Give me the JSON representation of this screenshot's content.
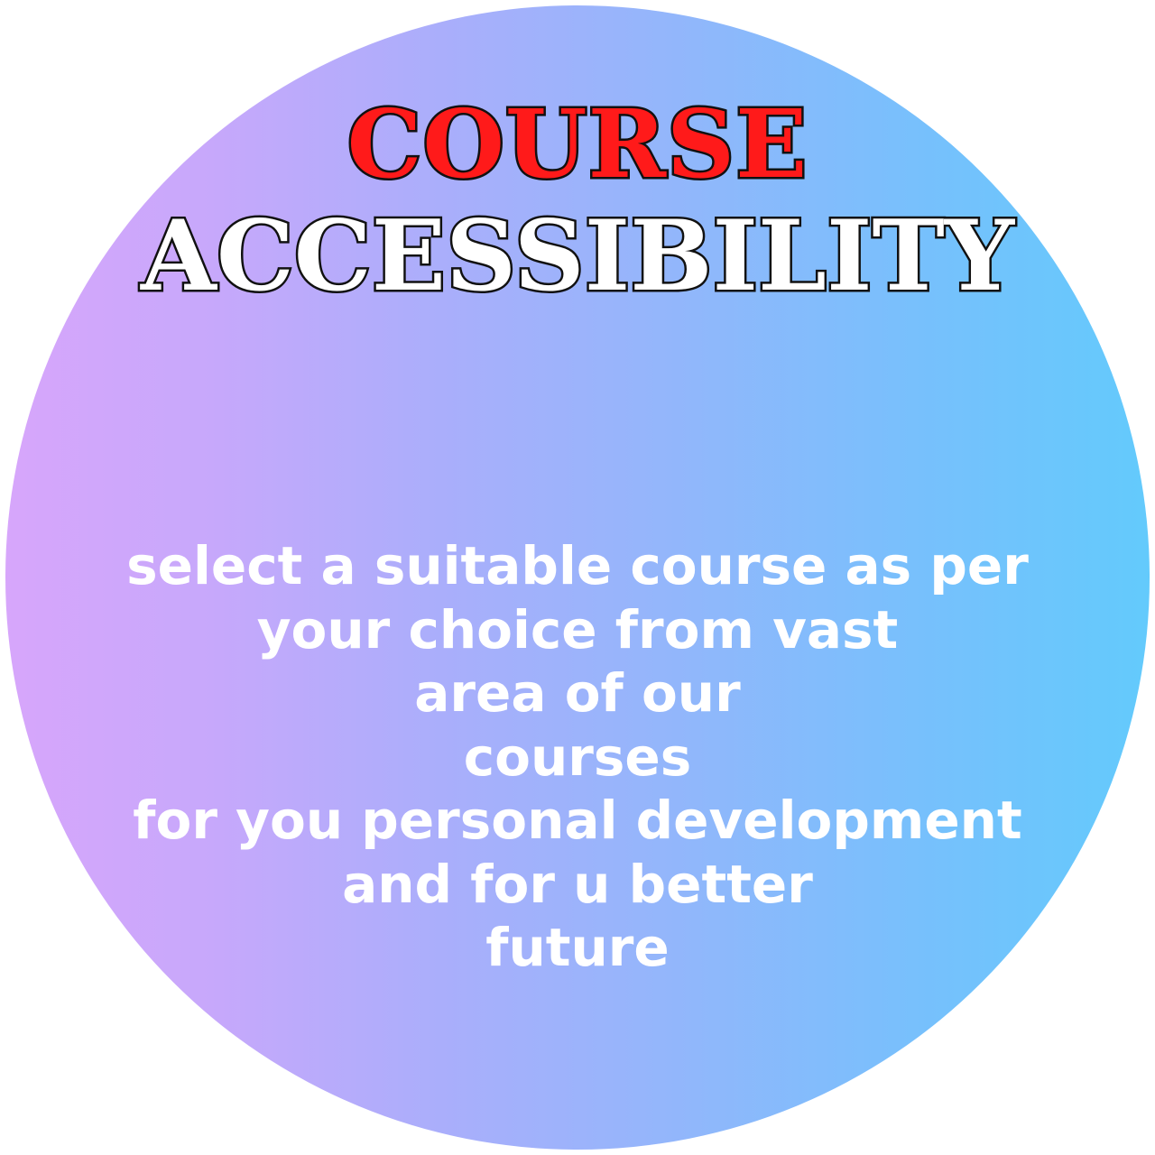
{
  "colors": {
    "background": "#ffffff",
    "gradient_left": "#d7a6fb",
    "gradient_right": "#63cafc",
    "title_primary": "#ff1a1a",
    "title_secondary": "#ffffff",
    "outline": "#111111",
    "body_text": "#ffffff"
  },
  "title": {
    "line1": "COURSE",
    "line2": "ACCESSIBILITY"
  },
  "body": {
    "lines": [
      "select a suitable course as per",
      "your choice from vast",
      "area of our",
      "courses",
      "for you personal development",
      "and for u better",
      "future"
    ]
  }
}
